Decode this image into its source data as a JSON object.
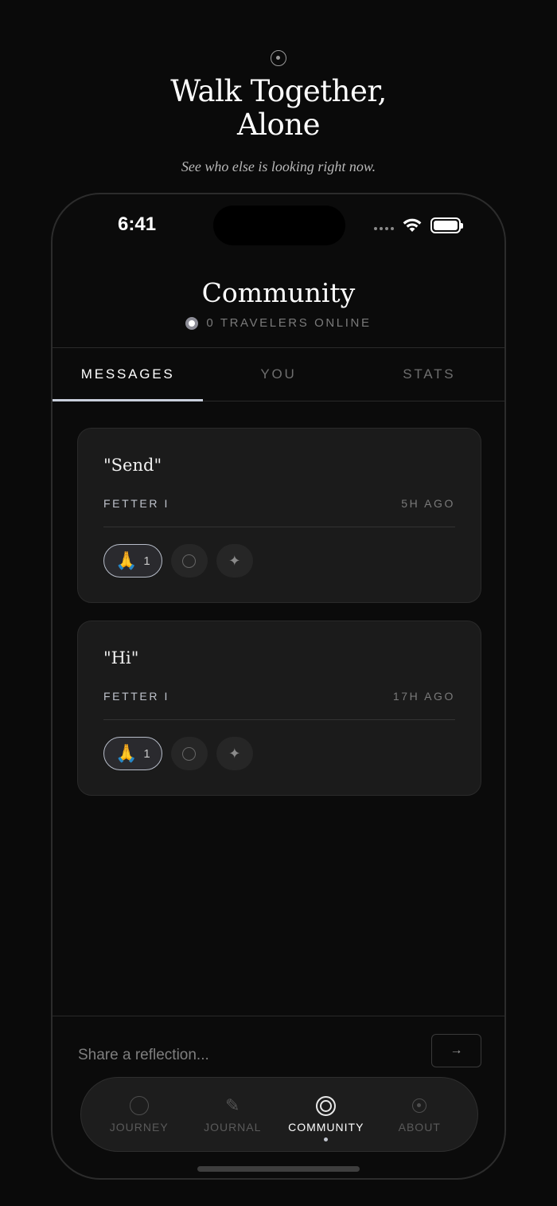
{
  "hero": {
    "title_line1": "Walk Together,",
    "title_line2": "Alone",
    "subtitle": "See who else is looking right now."
  },
  "status_bar": {
    "time": "6:41"
  },
  "screen": {
    "title": "Community",
    "online_text": "0 TRAVELERS ONLINE"
  },
  "tabs": [
    {
      "label": "MESSAGES",
      "active": true
    },
    {
      "label": "YOU",
      "active": false
    },
    {
      "label": "STATS",
      "active": false
    }
  ],
  "messages": [
    {
      "quote": "\"Send\"",
      "author": "FETTER I",
      "time": "5H AGO",
      "reaction_emoji": "🙏",
      "reaction_count": "1"
    },
    {
      "quote": "\"Hi\"",
      "author": "FETTER I",
      "time": "17H AGO",
      "reaction_emoji": "🙏",
      "reaction_count": "1"
    }
  ],
  "composer": {
    "placeholder": "Share a reflection...",
    "send_symbol": "→"
  },
  "nav": [
    {
      "label": "JOURNEY",
      "icon": "circle-icon"
    },
    {
      "label": "JOURNAL",
      "icon": "pencil-icon"
    },
    {
      "label": "COMMUNITY",
      "icon": "double-ring-icon",
      "active": true
    },
    {
      "label": "ABOUT",
      "icon": "dot-circle-icon"
    }
  ],
  "colors": {
    "background": "#0a0a0a",
    "card": "#1b1b1b",
    "accent": "#c9cfdc"
  }
}
